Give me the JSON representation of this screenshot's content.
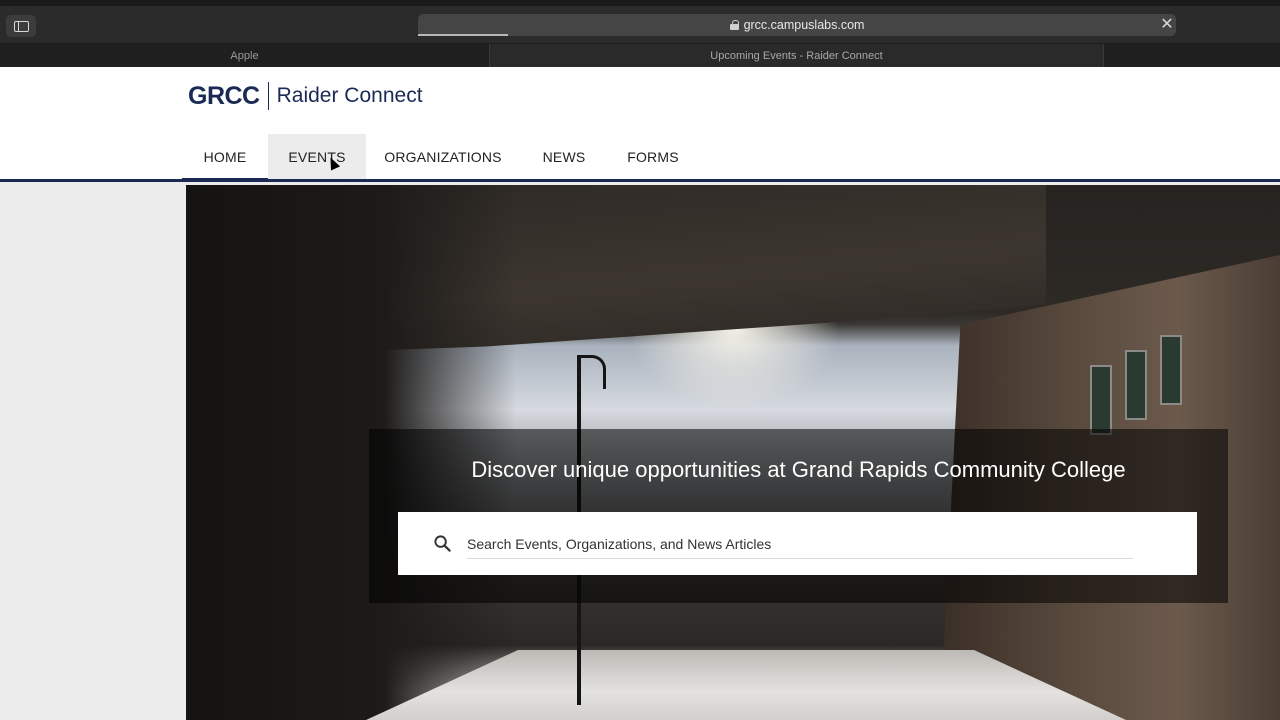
{
  "browser": {
    "url": "grcc.campuslabs.com",
    "tabs": [
      {
        "label": "Apple"
      },
      {
        "label": "Upcoming Events - Raider Connect"
      }
    ]
  },
  "site": {
    "logo_mark": "GRCC",
    "logo_text": "Raider Connect",
    "nav": [
      {
        "label": "HOME"
      },
      {
        "label": "EVENTS"
      },
      {
        "label": "ORGANIZATIONS"
      },
      {
        "label": "NEWS"
      },
      {
        "label": "FORMS"
      }
    ]
  },
  "hero": {
    "headline": "Discover unique opportunities at Grand Rapids Community College",
    "search_placeholder": "Search Events, Organizations, and News Articles"
  },
  "colors": {
    "brand_navy": "#1b2a55"
  }
}
